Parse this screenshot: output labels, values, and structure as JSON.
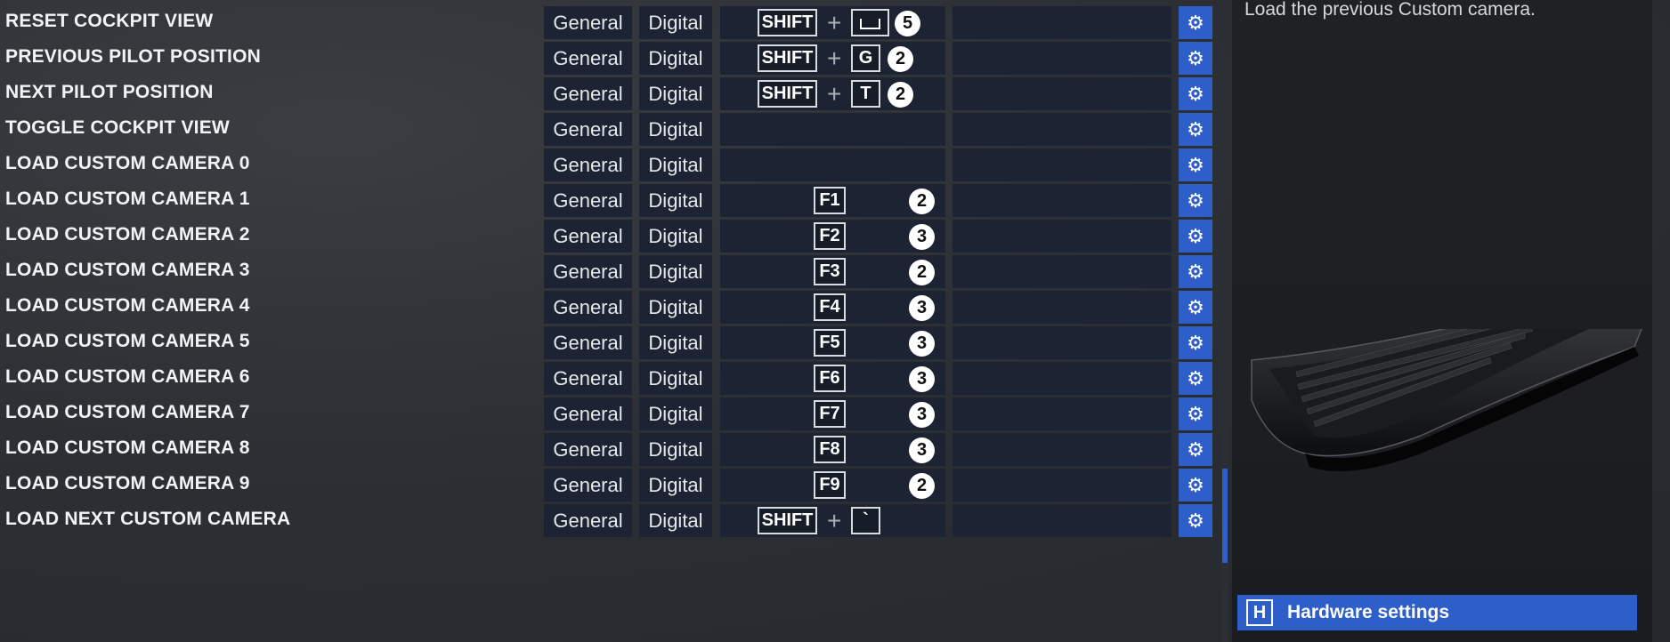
{
  "bindings_list": {
    "rows": [
      {
        "action": "RESET COCKPIT VIEW",
        "category": "General",
        "type": "Digital",
        "keys": [
          "SHIFT",
          "SPACE"
        ],
        "count": "5"
      },
      {
        "action": "PREVIOUS PILOT POSITION",
        "category": "General",
        "type": "Digital",
        "keys": [
          "SHIFT",
          "G"
        ],
        "count": "2"
      },
      {
        "action": "NEXT PILOT POSITION",
        "category": "General",
        "type": "Digital",
        "keys": [
          "SHIFT",
          "T"
        ],
        "count": "2"
      },
      {
        "action": "TOGGLE COCKPIT VIEW",
        "category": "General",
        "type": "Digital",
        "keys": [],
        "count": ""
      },
      {
        "action": "LOAD CUSTOM CAMERA 0",
        "category": "General",
        "type": "Digital",
        "keys": [],
        "count": ""
      },
      {
        "action": "LOAD CUSTOM CAMERA 1",
        "category": "General",
        "type": "Digital",
        "keys": [
          "F1"
        ],
        "count": "2"
      },
      {
        "action": "LOAD CUSTOM CAMERA 2",
        "category": "General",
        "type": "Digital",
        "keys": [
          "F2"
        ],
        "count": "3"
      },
      {
        "action": "LOAD CUSTOM CAMERA 3",
        "category": "General",
        "type": "Digital",
        "keys": [
          "F3"
        ],
        "count": "2"
      },
      {
        "action": "LOAD CUSTOM CAMERA 4",
        "category": "General",
        "type": "Digital",
        "keys": [
          "F4"
        ],
        "count": "3"
      },
      {
        "action": "LOAD CUSTOM CAMERA 5",
        "category": "General",
        "type": "Digital",
        "keys": [
          "F5"
        ],
        "count": "3"
      },
      {
        "action": "LOAD CUSTOM CAMERA 6",
        "category": "General",
        "type": "Digital",
        "keys": [
          "F6"
        ],
        "count": "3"
      },
      {
        "action": "LOAD CUSTOM CAMERA 7",
        "category": "General",
        "type": "Digital",
        "keys": [
          "F7"
        ],
        "count": "3"
      },
      {
        "action": "LOAD CUSTOM CAMERA 8",
        "category": "General",
        "type": "Digital",
        "keys": [
          "F8"
        ],
        "count": "3"
      },
      {
        "action": "LOAD CUSTOM CAMERA 9",
        "category": "General",
        "type": "Digital",
        "keys": [
          "F9"
        ],
        "count": "2"
      },
      {
        "action": "LOAD NEXT CUSTOM CAMERA",
        "category": "General",
        "type": "Digital",
        "keys": [
          "SHIFT",
          "`"
        ],
        "count": ""
      }
    ]
  },
  "plus_symbol": "+",
  "gear_icon": "gear-icon",
  "info_panel": {
    "description": "Load the previous Custom camera.",
    "device_image": "keyboard-image"
  },
  "hardware_button": {
    "key": "H",
    "label": "Hardware settings"
  },
  "colors": {
    "accent": "#2e5fc8",
    "cell_bg": "#1c2433",
    "panel_bg": "#1f2125"
  }
}
